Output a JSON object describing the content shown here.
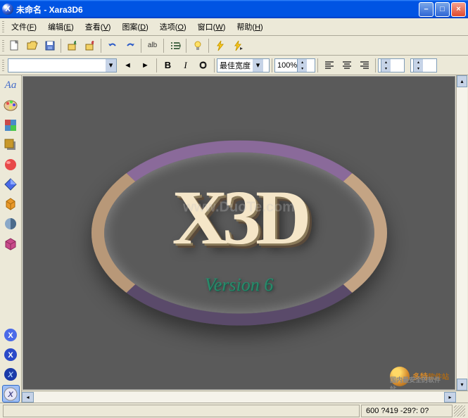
{
  "titlebar": {
    "icon": "X",
    "text": "未命名 - Xara3D6"
  },
  "winbtns": {
    "min": "–",
    "max": "□",
    "close": "×"
  },
  "menu": [
    {
      "label": "文件",
      "key": "F"
    },
    {
      "label": "编辑",
      "key": "E"
    },
    {
      "label": "查看",
      "key": "V"
    },
    {
      "label": "图案",
      "key": "D"
    },
    {
      "label": "选项",
      "key": "O"
    },
    {
      "label": "窗口",
      "key": "W"
    },
    {
      "label": "帮助",
      "key": "H"
    }
  ],
  "toolbar1": {
    "new": "new",
    "open": "open",
    "save": "save",
    "import": "import",
    "export": "export",
    "undo": "undo",
    "redo": "redo",
    "text": "alb",
    "list": "list",
    "bulb": "bulb",
    "bolt": "bolt",
    "anim": "anim"
  },
  "toolbar2": {
    "bold": "B",
    "italic": "I",
    "underline": "O",
    "fit_combo": "最佳宽度",
    "zoom": "100%",
    "align_left": "left",
    "align_center": "center",
    "align_right": "right"
  },
  "sidebar": [
    {
      "name": "text-style",
      "label": "Aa"
    },
    {
      "name": "color-palette",
      "label": "palette"
    },
    {
      "name": "texture",
      "label": "tex"
    },
    {
      "name": "shadow",
      "label": "shadow"
    },
    {
      "name": "sphere-red",
      "label": "sphere"
    },
    {
      "name": "bevel",
      "label": "bevel"
    },
    {
      "name": "extrude",
      "label": "extrude"
    },
    {
      "name": "shading",
      "label": "shading"
    },
    {
      "name": "box3d",
      "label": "box"
    },
    {
      "name": "x-blue",
      "label": "X"
    },
    {
      "name": "x-circle",
      "label": "X"
    },
    {
      "name": "x-badge",
      "label": "X"
    },
    {
      "name": "x-active",
      "label": "X"
    }
  ],
  "canvas": {
    "logo_main": "X3D",
    "logo_sub": "Version 6",
    "watermark": "www.DuoTe.com",
    "duote": "多特",
    "duote_suffix": "软件站",
    "duote_sub": "国内最安全的软件站"
  },
  "status": {
    "coords": "600 ?419  -29?: 0?"
  }
}
